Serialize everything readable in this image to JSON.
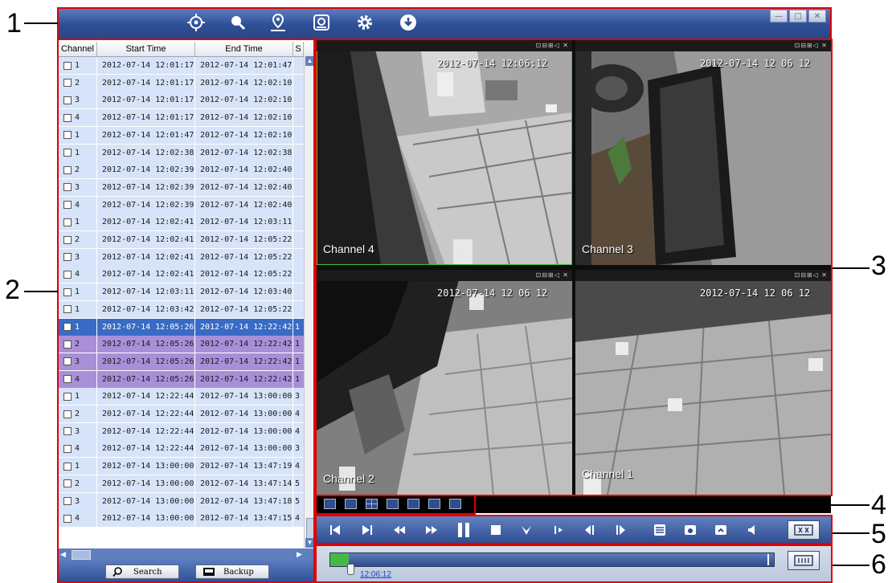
{
  "callouts": [
    "1",
    "2",
    "3",
    "4",
    "5",
    "6"
  ],
  "toolbar": {
    "icons": [
      "target-icon",
      "search-icon",
      "map-pin-icon",
      "disk-icon",
      "gear-icon",
      "download-icon"
    ],
    "window_controls": [
      "minimize-icon",
      "maximize-icon",
      "close-icon"
    ]
  },
  "list": {
    "headers": [
      "Channel",
      "Start Time",
      "End Time",
      "S"
    ],
    "rows": [
      {
        "ch": "1",
        "start": "2012-07-14 12:01:17",
        "end": "2012-07-14 12:01:47",
        "s": "",
        "state": "normal"
      },
      {
        "ch": "2",
        "start": "2012-07-14 12:01:17",
        "end": "2012-07-14 12:02:10",
        "s": "",
        "state": "normal"
      },
      {
        "ch": "3",
        "start": "2012-07-14 12:01:17",
        "end": "2012-07-14 12:02:10",
        "s": "",
        "state": "normal"
      },
      {
        "ch": "4",
        "start": "2012-07-14 12:01:17",
        "end": "2012-07-14 12:02:10",
        "s": "",
        "state": "normal"
      },
      {
        "ch": "1",
        "start": "2012-07-14 12:01:47",
        "end": "2012-07-14 12:02:10",
        "s": "",
        "state": "normal"
      },
      {
        "ch": "1",
        "start": "2012-07-14 12:02:38",
        "end": "2012-07-14 12:02:38",
        "s": "",
        "state": "normal"
      },
      {
        "ch": "2",
        "start": "2012-07-14 12:02:39",
        "end": "2012-07-14 12:02:40",
        "s": "",
        "state": "normal"
      },
      {
        "ch": "3",
        "start": "2012-07-14 12:02:39",
        "end": "2012-07-14 12:02:40",
        "s": "",
        "state": "normal"
      },
      {
        "ch": "4",
        "start": "2012-07-14 12:02:39",
        "end": "2012-07-14 12:02:40",
        "s": "",
        "state": "normal"
      },
      {
        "ch": "1",
        "start": "2012-07-14 12:02:41",
        "end": "2012-07-14 12:03:11",
        "s": "",
        "state": "normal"
      },
      {
        "ch": "2",
        "start": "2012-07-14 12:02:41",
        "end": "2012-07-14 12:05:22",
        "s": "",
        "state": "normal"
      },
      {
        "ch": "3",
        "start": "2012-07-14 12:02:41",
        "end": "2012-07-14 12:05:22",
        "s": "",
        "state": "normal"
      },
      {
        "ch": "4",
        "start": "2012-07-14 12:02:41",
        "end": "2012-07-14 12:05:22",
        "s": "",
        "state": "normal"
      },
      {
        "ch": "1",
        "start": "2012-07-14 12:03:11",
        "end": "2012-07-14 12:03:40",
        "s": "",
        "state": "normal"
      },
      {
        "ch": "1",
        "start": "2012-07-14 12:03:42",
        "end": "2012-07-14 12:05:22",
        "s": "",
        "state": "normal"
      },
      {
        "ch": "1",
        "start": "2012-07-14 12:05:26",
        "end": "2012-07-14 12:22:42",
        "s": "1",
        "state": "selected"
      },
      {
        "ch": "2",
        "start": "2012-07-14 12:05:26",
        "end": "2012-07-14 12:22:42",
        "s": "1",
        "state": "group"
      },
      {
        "ch": "3",
        "start": "2012-07-14 12:05:26",
        "end": "2012-07-14 12:22:42",
        "s": "1",
        "state": "group"
      },
      {
        "ch": "4",
        "start": "2012-07-14 12:05:26",
        "end": "2012-07-14 12:22:42",
        "s": "1",
        "state": "group"
      },
      {
        "ch": "1",
        "start": "2012-07-14 12:22:44",
        "end": "2012-07-14 13:00:00",
        "s": "3",
        "state": "normal"
      },
      {
        "ch": "2",
        "start": "2012-07-14 12:22:44",
        "end": "2012-07-14 13:00:00",
        "s": "4",
        "state": "normal"
      },
      {
        "ch": "3",
        "start": "2012-07-14 12:22:44",
        "end": "2012-07-14 13:00:00",
        "s": "4",
        "state": "normal"
      },
      {
        "ch": "4",
        "start": "2012-07-14 12:22:44",
        "end": "2012-07-14 13:00:00",
        "s": "3",
        "state": "normal"
      },
      {
        "ch": "1",
        "start": "2012-07-14 13:00:00",
        "end": "2012-07-14 13:47:19",
        "s": "4",
        "state": "normal"
      },
      {
        "ch": "2",
        "start": "2012-07-14 13:00:00",
        "end": "2012-07-14 13:47:14",
        "s": "5",
        "state": "normal"
      },
      {
        "ch": "3",
        "start": "2012-07-14 13:00:00",
        "end": "2012-07-14 13:47:18",
        "s": "5",
        "state": "normal"
      },
      {
        "ch": "4",
        "start": "2012-07-14 13:00:00",
        "end": "2012-07-14 13:47:15",
        "s": "4",
        "state": "normal"
      }
    ],
    "search_label": "Search",
    "backup_label": "Backup"
  },
  "video": {
    "tiles": [
      {
        "timestamp": "2012-07-14 12:06:12",
        "channel": "Channel 4",
        "active": true
      },
      {
        "timestamp": "2012-07-14 12 06 12",
        "channel": "Channel 3",
        "active": false
      },
      {
        "timestamp": "2012-07-14 12 06 12",
        "channel": "Channel 2",
        "active": false
      },
      {
        "timestamp": "2012-07-14 12 06 12",
        "channel": "Channel 1",
        "active": false
      }
    ],
    "tile_icons": "⊡⊟⊞◁ ✕"
  },
  "timeline": {
    "current_time": "12:06:12"
  },
  "colors": {
    "row_normal": "#d6e3f8",
    "row_selected": "#3a6bc4",
    "row_group": "#a88fd8",
    "callout_box": "#e10000",
    "toolbar": "#2e4f96"
  }
}
